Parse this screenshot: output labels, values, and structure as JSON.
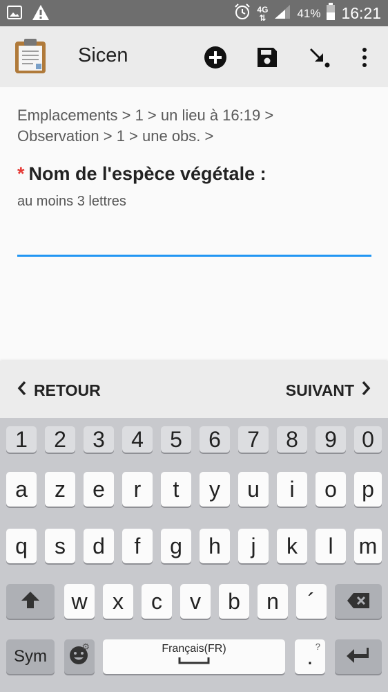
{
  "status_bar": {
    "network": "4G",
    "battery": "41%",
    "time": "16:21",
    "icons": [
      "image-icon",
      "warning-icon",
      "alarm-icon",
      "signal-icon",
      "battery-icon"
    ]
  },
  "app_bar": {
    "title": "Sicen",
    "actions": [
      "add-icon",
      "save-icon",
      "arrow-down-right-icon",
      "more-vert-icon"
    ]
  },
  "form": {
    "breadcrumb_line1": "Emplacements > 1 > un lieu à 16:19 >",
    "breadcrumb_line2": "Observation > 1 > une obs.  >",
    "required_mark": "*",
    "label": "Nom de l'espèce végétale :",
    "hint": "au moins 3 lettres",
    "value": ""
  },
  "nav": {
    "back": "RETOUR",
    "next": "SUIVANT"
  },
  "keyboard": {
    "row_numbers": [
      "1",
      "2",
      "3",
      "4",
      "5",
      "6",
      "7",
      "8",
      "9",
      "0"
    ],
    "row1": [
      "a",
      "z",
      "e",
      "r",
      "t",
      "y",
      "u",
      "i",
      "o",
      "p"
    ],
    "row2": [
      "q",
      "s",
      "d",
      "f",
      "g",
      "h",
      "j",
      "k",
      "l",
      "m"
    ],
    "row3": [
      "w",
      "x",
      "c",
      "v",
      "b",
      "n",
      "´"
    ],
    "sym": "Sym",
    "language": "Français(FR)",
    "punct": ".",
    "punct_sub": "?"
  },
  "colors": {
    "accent": "#2196f3",
    "required": "#e53935",
    "status_bar": "#6e6e6e",
    "app_bar": "#ebebeb"
  }
}
